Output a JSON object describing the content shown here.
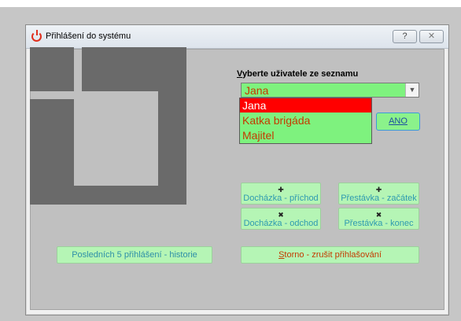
{
  "window": {
    "title": "Přihlášení do systému",
    "help_button": "?",
    "close_button": "✕"
  },
  "login": {
    "label_prefix": "V",
    "label_rest": "yberte uživatele ze seznamu",
    "selected_user": "Jana",
    "users": [
      "Jana",
      "Katka brigáda",
      "Majitel"
    ],
    "ok_button": "ANO"
  },
  "attendance": {
    "arrival": "Docházka - příchod",
    "break_start": "Přestávka - začátek",
    "departure": "Docházka - odchod",
    "break_end": "Přestávka - konec"
  },
  "history_button": "Posledních 5 přihlášení - historie",
  "cancel": {
    "prefix": "S",
    "rest": "torno - zrušit přihlašování"
  },
  "colors": {
    "panel_gray": "#c0c0c0",
    "logo_gray": "#6a6a6a",
    "button_green": "#b5f5b5",
    "combo_green": "#7ef27e",
    "selected_red": "#ff0000"
  }
}
